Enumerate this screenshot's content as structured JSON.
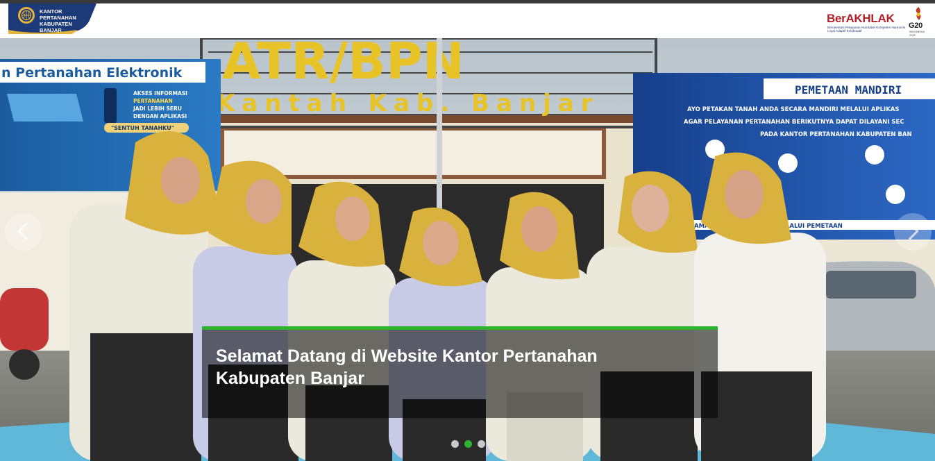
{
  "header": {
    "org_name_line1": "KANTOR PERTANAHAN",
    "org_name_line2": "KABUPATEN BANJAR",
    "logo_icon": "bpn-emblem-icon",
    "brand_badge": {
      "word": "BerAKHLAK",
      "tagline": "Berorientasi Pelayanan Akuntabel Kompeten Harmonis Loyal Adaptif Kolaboratif"
    },
    "g20": {
      "label": "G20",
      "sub_line1": "INDONESIA",
      "sub_line2": "2022"
    }
  },
  "hero": {
    "slide_caption": "Selamat Datang di Website Kantor Pertanahan Kabupaten Banjar",
    "active_slide_index": 1,
    "slide_count": 3,
    "background_signs": {
      "building_sign_1": "ATR/BPN",
      "building_sign_2": "Kantah Kab. Banjar",
      "left_banner": "n Pertanahan Elektronik",
      "left_banner_sub": "AKSES INFORMASI PERTANAHAN JADI LEBIH SERU DENGAN APLIKASI",
      "left_banner_app": "\"SENTUH TANAHKU\"",
      "right_banner": "PEMETAAN MANDIRI",
      "right_banner_sub1": "AYO PETAKAN TANAH ANDA SECARA MANDIRI MELALUI APLIKAS",
      "right_banner_sub2": "AGAR PELAYANAN PERTANAHAN BERIKUTNYA DAPAT DILAYANI SEC",
      "right_banner_sub3": "PADA KANTOR PERTANAHAN KABUPATEN BAN",
      "right_banner_bottom": "AMANKAN TANAH ANDA MELALUI PEMETAAN"
    }
  },
  "controls": {
    "prev_icon": "chevron-left-icon",
    "next_icon": "chevron-right-icon"
  },
  "colors": {
    "accent_green": "#2cb52c",
    "brand_navy": "#1d3a78",
    "brand_gold": "#e6b43a",
    "brand_red": "#b3202a"
  }
}
